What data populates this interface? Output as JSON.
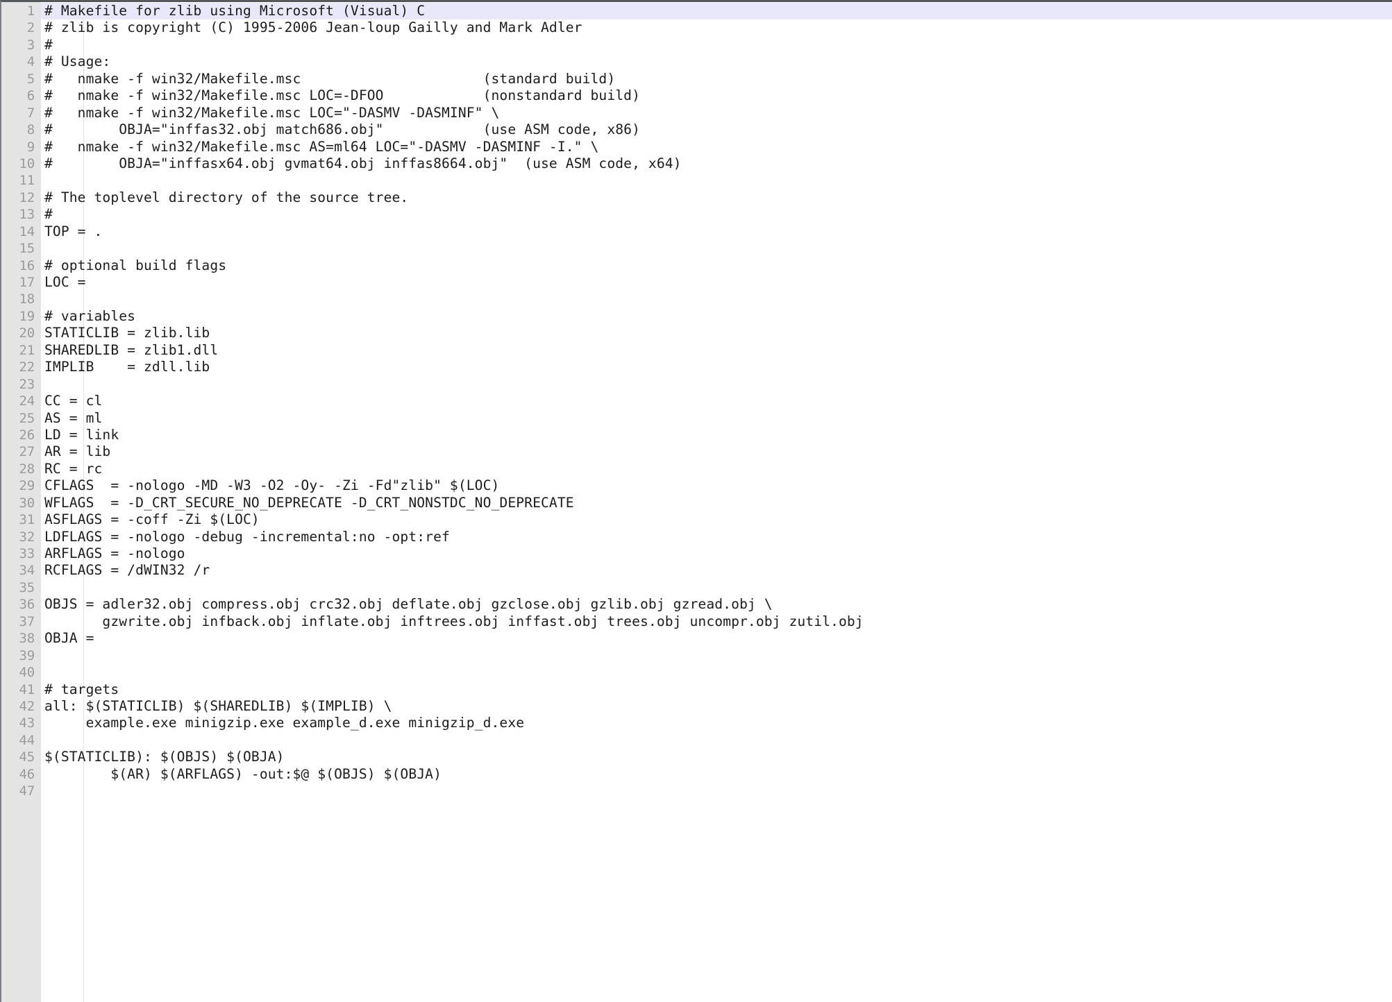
{
  "app": {
    "kind": "code-editor",
    "file_language": "makefile",
    "colors": {
      "background": "#ffffff",
      "gutter_background": "#e4e4e4",
      "gutter_text": "#9b9b9b",
      "code_text": "#1c1c1c",
      "current_line_highlight": "#e8e8fa",
      "top_border": "#55585c",
      "indent_guide": "#e2e2e2"
    },
    "current_line": 1,
    "first_visible_line": 1,
    "last_visible_line": 47
  },
  "editor": {
    "lines": [
      {
        "n": "1",
        "text": "# Makefile for zlib using Microsoft (Visual) C"
      },
      {
        "n": "2",
        "text": "# zlib is copyright (C) 1995-2006 Jean-loup Gailly and Mark Adler"
      },
      {
        "n": "3",
        "text": "#"
      },
      {
        "n": "4",
        "text": "# Usage:"
      },
      {
        "n": "5",
        "text": "#   nmake -f win32/Makefile.msc                      (standard build)"
      },
      {
        "n": "6",
        "text": "#   nmake -f win32/Makefile.msc LOC=-DFOO            (nonstandard build)"
      },
      {
        "n": "7",
        "text": "#   nmake -f win32/Makefile.msc LOC=\"-DASMV -DASMINF\" \\"
      },
      {
        "n": "8",
        "text": "#        OBJA=\"inffas32.obj match686.obj\"            (use ASM code, x86)"
      },
      {
        "n": "9",
        "text": "#   nmake -f win32/Makefile.msc AS=ml64 LOC=\"-DASMV -DASMINF -I.\" \\"
      },
      {
        "n": "10",
        "text": "#        OBJA=\"inffasx64.obj gvmat64.obj inffas8664.obj\"  (use ASM code, x64)"
      },
      {
        "n": "11",
        "text": ""
      },
      {
        "n": "12",
        "text": "# The toplevel directory of the source tree."
      },
      {
        "n": "13",
        "text": "#"
      },
      {
        "n": "14",
        "text": "TOP = ."
      },
      {
        "n": "15",
        "text": ""
      },
      {
        "n": "16",
        "text": "# optional build flags"
      },
      {
        "n": "17",
        "text": "LOC ="
      },
      {
        "n": "18",
        "text": ""
      },
      {
        "n": "19",
        "text": "# variables"
      },
      {
        "n": "20",
        "text": "STATICLIB = zlib.lib"
      },
      {
        "n": "21",
        "text": "SHAREDLIB = zlib1.dll"
      },
      {
        "n": "22",
        "text": "IMPLIB    = zdll.lib"
      },
      {
        "n": "23",
        "text": ""
      },
      {
        "n": "24",
        "text": "CC = cl"
      },
      {
        "n": "25",
        "text": "AS = ml"
      },
      {
        "n": "26",
        "text": "LD = link"
      },
      {
        "n": "27",
        "text": "AR = lib"
      },
      {
        "n": "28",
        "text": "RC = rc"
      },
      {
        "n": "29",
        "text": "CFLAGS  = -nologo -MD -W3 -O2 -Oy- -Zi -Fd\"zlib\" $(LOC)"
      },
      {
        "n": "30",
        "text": "WFLAGS  = -D_CRT_SECURE_NO_DEPRECATE -D_CRT_NONSTDC_NO_DEPRECATE"
      },
      {
        "n": "31",
        "text": "ASFLAGS = -coff -Zi $(LOC)"
      },
      {
        "n": "32",
        "text": "LDFLAGS = -nologo -debug -incremental:no -opt:ref"
      },
      {
        "n": "33",
        "text": "ARFLAGS = -nologo"
      },
      {
        "n": "34",
        "text": "RCFLAGS = /dWIN32 /r"
      },
      {
        "n": "35",
        "text": ""
      },
      {
        "n": "36",
        "text": "OBJS = adler32.obj compress.obj crc32.obj deflate.obj gzclose.obj gzlib.obj gzread.obj \\"
      },
      {
        "n": "37",
        "text": "       gzwrite.obj infback.obj inflate.obj inftrees.obj inffast.obj trees.obj uncompr.obj zutil.obj"
      },
      {
        "n": "38",
        "text": "OBJA ="
      },
      {
        "n": "39",
        "text": ""
      },
      {
        "n": "40",
        "text": ""
      },
      {
        "n": "41",
        "text": "# targets"
      },
      {
        "n": "42",
        "text": "all: $(STATICLIB) $(SHAREDLIB) $(IMPLIB) \\"
      },
      {
        "n": "43",
        "text": "     example.exe minigzip.exe example_d.exe minigzip_d.exe"
      },
      {
        "n": "44",
        "text": ""
      },
      {
        "n": "45",
        "text": "$(STATICLIB): $(OBJS) $(OBJA)"
      },
      {
        "n": "46",
        "text": "\t$(AR) $(ARFLAGS) -out:$@ $(OBJS) $(OBJA)"
      },
      {
        "n": "47",
        "text": ""
      }
    ]
  }
}
